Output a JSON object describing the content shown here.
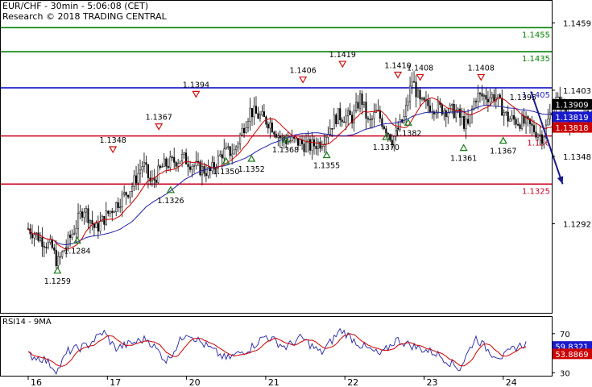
{
  "header": {
    "title": "EUR/CHF - 30min - 5:06:08 (CET)",
    "credit": "Research © 2018 TRADING CENTRAL"
  },
  "rsi_panel": {
    "title": "RSI14 - 9MA"
  },
  "colors": {
    "resistance_green": "#008000",
    "pivot_blue": "#1a1acc",
    "support_red": "#cc0022",
    "price": "#000000",
    "ma_fast": "#cc0000",
    "ma_slow": "#2222aa",
    "arrow": "#1a1a8c",
    "last_price_bg": "#000000",
    "ma_fast_bg": "#cc0000",
    "ma_slow_bg": "#1a1acc",
    "up_marker": "#1a7a1a",
    "down_marker": "#d01010"
  },
  "chart_data": [
    {
      "type": "candlestick",
      "title": "EUR/CHF - 30min",
      "x_labels": [
        "16",
        "17",
        "20",
        "21",
        "22",
        "23",
        "24"
      ],
      "y_ticks": [
        1.1459,
        1.1403,
        1.1348,
        1.1292
      ],
      "ylim": [
        1.1218,
        1.1478
      ],
      "grid": false,
      "price_path": [
        {
          "d": 0.0,
          "v": 1.1288
        },
        {
          "d": 0.3,
          "v": 1.1272
        },
        {
          "d": 0.37,
          "v": 1.1259
        },
        {
          "d": 0.6,
          "v": 1.129
        },
        {
          "d": 0.7,
          "v": 1.1306
        },
        {
          "d": 0.85,
          "v": 1.1287
        },
        {
          "d": 1.0,
          "v": 1.13
        },
        {
          "d": 1.3,
          "v": 1.1322
        },
        {
          "d": 1.45,
          "v": 1.1342
        },
        {
          "d": 1.55,
          "v": 1.1325
        },
        {
          "d": 1.7,
          "v": 1.134
        },
        {
          "d": 1.95,
          "v": 1.1347
        },
        {
          "d": 2.15,
          "v": 1.1338
        },
        {
          "d": 2.3,
          "v": 1.1335
        },
        {
          "d": 2.45,
          "v": 1.1351
        },
        {
          "d": 2.6,
          "v": 1.1352
        },
        {
          "d": 2.8,
          "v": 1.1386
        },
        {
          "d": 3.05,
          "v": 1.1376
        },
        {
          "d": 3.2,
          "v": 1.1362
        },
        {
          "d": 3.4,
          "v": 1.136
        },
        {
          "d": 3.55,
          "v": 1.1356
        },
        {
          "d": 3.7,
          "v": 1.136
        },
        {
          "d": 3.9,
          "v": 1.1382
        },
        {
          "d": 4.1,
          "v": 1.138
        },
        {
          "d": 4.2,
          "v": 1.1398
        },
        {
          "d": 4.3,
          "v": 1.1374
        },
        {
          "d": 4.4,
          "v": 1.1385
        },
        {
          "d": 4.6,
          "v": 1.1362
        },
        {
          "d": 4.75,
          "v": 1.138
        },
        {
          "d": 4.85,
          "v": 1.1412
        },
        {
          "d": 4.95,
          "v": 1.1392
        },
        {
          "d": 5.2,
          "v": 1.1388
        },
        {
          "d": 5.4,
          "v": 1.1385
        },
        {
          "d": 5.55,
          "v": 1.1372
        },
        {
          "d": 5.65,
          "v": 1.1398
        },
        {
          "d": 5.9,
          "v": 1.1398
        },
        {
          "d": 6.05,
          "v": 1.138
        },
        {
          "d": 6.3,
          "v": 1.1375
        },
        {
          "d": 6.5,
          "v": 1.1364
        },
        {
          "d": 6.65,
          "v": 1.1395
        },
        {
          "d": 6.75,
          "v": 1.139
        },
        {
          "d": 6.9,
          "v": 1.1372
        },
        {
          "d": 7.0,
          "v": 1.1378
        },
        {
          "d": 7.15,
          "v": 1.1385
        },
        {
          "d": 7.35,
          "v": 1.1382
        },
        {
          "d": 7.55,
          "v": 1.1391
        }
      ],
      "levels": [
        {
          "value": 1.1455,
          "label": "1.1455",
          "kind": "resistance"
        },
        {
          "value": 1.1435,
          "label": "1.1435",
          "kind": "resistance"
        },
        {
          "value": 1.1405,
          "label": "1.1405",
          "kind": "pivot"
        },
        {
          "value": 1.1365,
          "label": "1.136",
          "kind": "support"
        },
        {
          "value": 1.1325,
          "label": "1.1325",
          "kind": "support"
        }
      ],
      "price_tags": [
        {
          "value": 1.13909,
          "label": "1.13909",
          "kind": "last"
        },
        {
          "value": 1.13819,
          "label": "1.13819",
          "kind": "ma_slow"
        },
        {
          "value": 1.13818,
          "label": "1.13818",
          "kind": "ma_fast"
        }
      ],
      "swing_annotations": [
        {
          "d": 0.37,
          "v": 1.1259,
          "label": "1.1259",
          "kind": "low"
        },
        {
          "d": 0.62,
          "v": 1.1284,
          "label": "1.1284",
          "kind": "low"
        },
        {
          "d": 1.07,
          "v": 1.1348,
          "label": "1.1348",
          "kind": "high"
        },
        {
          "d": 1.65,
          "v": 1.1367,
          "label": "1.1367",
          "kind": "high"
        },
        {
          "d": 1.8,
          "v": 1.1326,
          "label": "1.1326",
          "kind": "low"
        },
        {
          "d": 2.12,
          "v": 1.1394,
          "label": "1.1394",
          "kind": "high"
        },
        {
          "d": 2.5,
          "v": 1.135,
          "label": "1.1350",
          "kind": "low"
        },
        {
          "d": 2.82,
          "v": 1.1352,
          "label": "1.1352",
          "kind": "low"
        },
        {
          "d": 3.25,
          "v": 1.1368,
          "label": "1.1368",
          "kind": "low"
        },
        {
          "d": 3.47,
          "v": 1.1406,
          "label": "1.1406",
          "kind": "high"
        },
        {
          "d": 3.77,
          "v": 1.1355,
          "label": "1.1355",
          "kind": "low"
        },
        {
          "d": 3.97,
          "v": 1.1419,
          "label": "1.1419",
          "kind": "high"
        },
        {
          "d": 4.52,
          "v": 1.137,
          "label": "1.1370",
          "kind": "low"
        },
        {
          "d": 4.67,
          "v": 1.141,
          "label": "1.1410",
          "kind": "high"
        },
        {
          "d": 4.8,
          "v": 1.1382,
          "label": "1.1382",
          "kind": "low"
        },
        {
          "d": 4.95,
          "v": 1.1408,
          "label": "1.1408",
          "kind": "high"
        },
        {
          "d": 5.5,
          "v": 1.1361,
          "label": "1.1361",
          "kind": "low"
        },
        {
          "d": 5.72,
          "v": 1.1408,
          "label": "1.1408",
          "kind": "high"
        },
        {
          "d": 6.0,
          "v": 1.1367,
          "label": "1.1367",
          "kind": "low"
        },
        {
          "d": 6.25,
          "v": 1.1395,
          "label": "1.1395",
          "kind": "plain"
        }
      ],
      "projection": {
        "from": {
          "d": 6.35,
          "v": 1.1402
        },
        "to": {
          "d": 6.75,
          "v": 1.1325
        }
      }
    },
    {
      "type": "line",
      "title": "RSI14 - 9MA",
      "y_ticks": [
        70,
        50,
        30
      ],
      "ylim": [
        27,
        88
      ],
      "rsi_path": [
        {
          "d": 0.0,
          "v": 48
        },
        {
          "d": 0.2,
          "v": 44
        },
        {
          "d": 0.37,
          "v": 32
        },
        {
          "d": 0.5,
          "v": 52
        },
        {
          "d": 0.75,
          "v": 58
        },
        {
          "d": 0.95,
          "v": 72
        },
        {
          "d": 1.1,
          "v": 55
        },
        {
          "d": 1.3,
          "v": 60
        },
        {
          "d": 1.5,
          "v": 65
        },
        {
          "d": 1.75,
          "v": 42
        },
        {
          "d": 2.0,
          "v": 72
        },
        {
          "d": 2.2,
          "v": 60
        },
        {
          "d": 2.5,
          "v": 44
        },
        {
          "d": 2.8,
          "v": 55
        },
        {
          "d": 3.0,
          "v": 68
        },
        {
          "d": 3.25,
          "v": 56
        },
        {
          "d": 3.45,
          "v": 66
        },
        {
          "d": 3.7,
          "v": 50
        },
        {
          "d": 3.95,
          "v": 74
        },
        {
          "d": 4.2,
          "v": 58
        },
        {
          "d": 4.45,
          "v": 48
        },
        {
          "d": 4.65,
          "v": 64
        },
        {
          "d": 4.9,
          "v": 56
        },
        {
          "d": 5.15,
          "v": 50
        },
        {
          "d": 5.45,
          "v": 34
        },
        {
          "d": 5.65,
          "v": 66
        },
        {
          "d": 5.85,
          "v": 50
        },
        {
          "d": 6.0,
          "v": 46
        },
        {
          "d": 6.15,
          "v": 56
        },
        {
          "d": 6.3,
          "v": 60
        }
      ],
      "tags": [
        {
          "value": 59.8321,
          "label": "59.8321",
          "kind": "rsi"
        },
        {
          "value": 53.8869,
          "label": "53.8869",
          "kind": "ma"
        }
      ]
    }
  ]
}
